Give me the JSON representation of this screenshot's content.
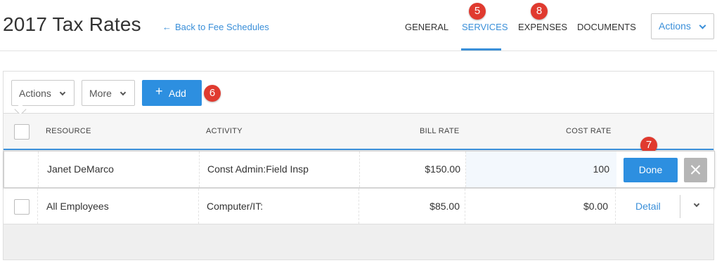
{
  "header": {
    "title": "2017 Tax Rates",
    "back_link": "Back to Fee Schedules",
    "tabs": [
      {
        "label": "GENERAL"
      },
      {
        "label": "SERVICES",
        "active": true
      },
      {
        "label": "EXPENSES"
      },
      {
        "label": "DOCUMENTS"
      }
    ],
    "actions_label": "Actions"
  },
  "annotations": [
    "5",
    "8",
    "6",
    "7"
  ],
  "toolbar": {
    "actions_label": "Actions",
    "more_label": "More",
    "add_label": "Add"
  },
  "table": {
    "columns": [
      "RESOURCE",
      "ACTIVITY",
      "BILL RATE",
      "COST RATE"
    ],
    "rows": [
      {
        "resource": "Janet DeMarco",
        "activity": "Const Admin:Field Insp",
        "bill_rate": "$150.00",
        "cost_rate": "100",
        "editing": true
      },
      {
        "resource": "All Employees",
        "activity": "Computer/IT:",
        "bill_rate": "$85.00",
        "cost_rate": "$0.00",
        "editing": false
      }
    ],
    "done_label": "Done",
    "detail_label": "Detail"
  },
  "colors": {
    "accent": "#3a8fd9",
    "primary_button": "#2d8fe0",
    "badge": "#e03a2f"
  }
}
